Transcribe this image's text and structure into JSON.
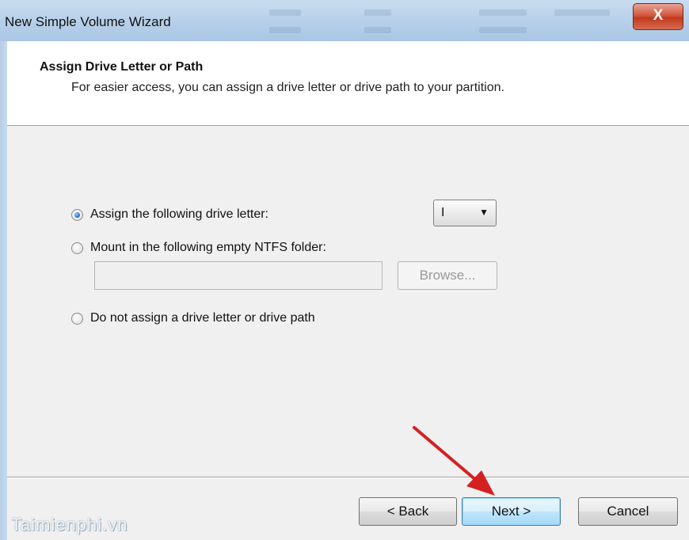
{
  "window": {
    "title": "New Simple Volume Wizard",
    "close_label": "X"
  },
  "header": {
    "title": "Assign Drive Letter or Path",
    "subtitle": "For easier access, you can assign a drive letter or drive path to your partition."
  },
  "options": {
    "assign_letter": {
      "label": "Assign the following drive letter:",
      "selected": true
    },
    "mount_folder": {
      "label": "Mount in the following empty NTFS folder:",
      "selected": false
    },
    "no_assign": {
      "label": "Do not assign a drive letter or drive path",
      "selected": false
    }
  },
  "drive_letter": {
    "value": "I"
  },
  "folder_path": {
    "value": "",
    "browse_label": "Browse..."
  },
  "buttons": {
    "back": "< Back",
    "next": "Next >",
    "cancel": "Cancel"
  },
  "annotation": {
    "arrow_color": "#d42020"
  },
  "watermark": "Taimienphi.vn",
  "colors": {
    "titlebar": "#b9d1ea",
    "close_button": "#c0391f",
    "default_button_border": "#3c7fb1"
  }
}
